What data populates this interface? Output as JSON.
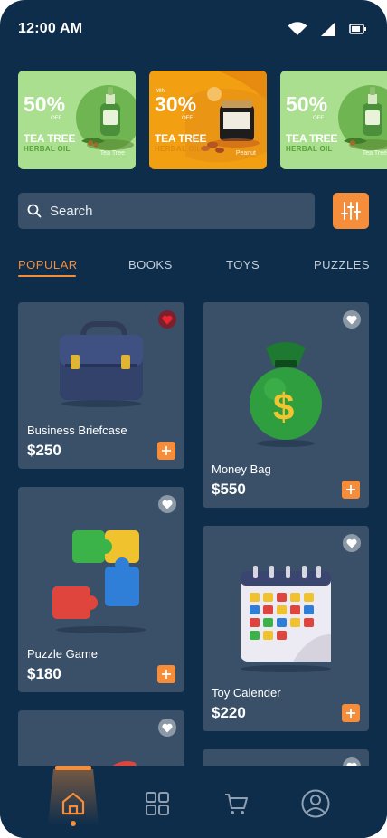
{
  "status_bar": {
    "time": "12:00 AM",
    "icons": [
      "wifi-icon",
      "signal-icon",
      "battery-icon"
    ]
  },
  "banners": [
    {
      "percent": "50%",
      "off": "OFF",
      "title": "TEA TREE",
      "subtitle": "HERBAL OIL",
      "brand": "Tea Tree",
      "theme": "green"
    },
    {
      "min": "MIN",
      "percent": "30%",
      "off": "OFF",
      "title": "TEA TREE",
      "subtitle": "HERBAL OIL",
      "brand": "Peanut",
      "theme": "orange"
    },
    {
      "percent": "50%",
      "off": "OFF",
      "title": "TEA TREE",
      "subtitle": "HERBAL OIL",
      "brand": "Tea Tree",
      "theme": "green"
    }
  ],
  "search": {
    "placeholder": "Search",
    "icon": "search-icon",
    "filter_icon": "sliders-icon"
  },
  "tabs": [
    {
      "label": "POPULAR",
      "active": true
    },
    {
      "label": "BOOKS",
      "active": false
    },
    {
      "label": "TOYS",
      "active": false
    },
    {
      "label": "PUZZLES",
      "active": false
    }
  ],
  "products": [
    {
      "name": "Business Briefcase",
      "price": "$250",
      "favorite": true
    },
    {
      "name": "Money Bag",
      "price": "$550",
      "favorite": false
    },
    {
      "name": "Puzzle Game",
      "price": "$180",
      "favorite": false
    },
    {
      "name": "Toy Calender",
      "price": "$220",
      "favorite": false
    }
  ],
  "nav": {
    "items": [
      "home-icon",
      "grid-icon",
      "cart-icon",
      "profile-icon"
    ],
    "active": "home-icon"
  },
  "colors": {
    "background": "#0d2d4b",
    "card": "#3a5068",
    "accent": "#f58d3a"
  }
}
